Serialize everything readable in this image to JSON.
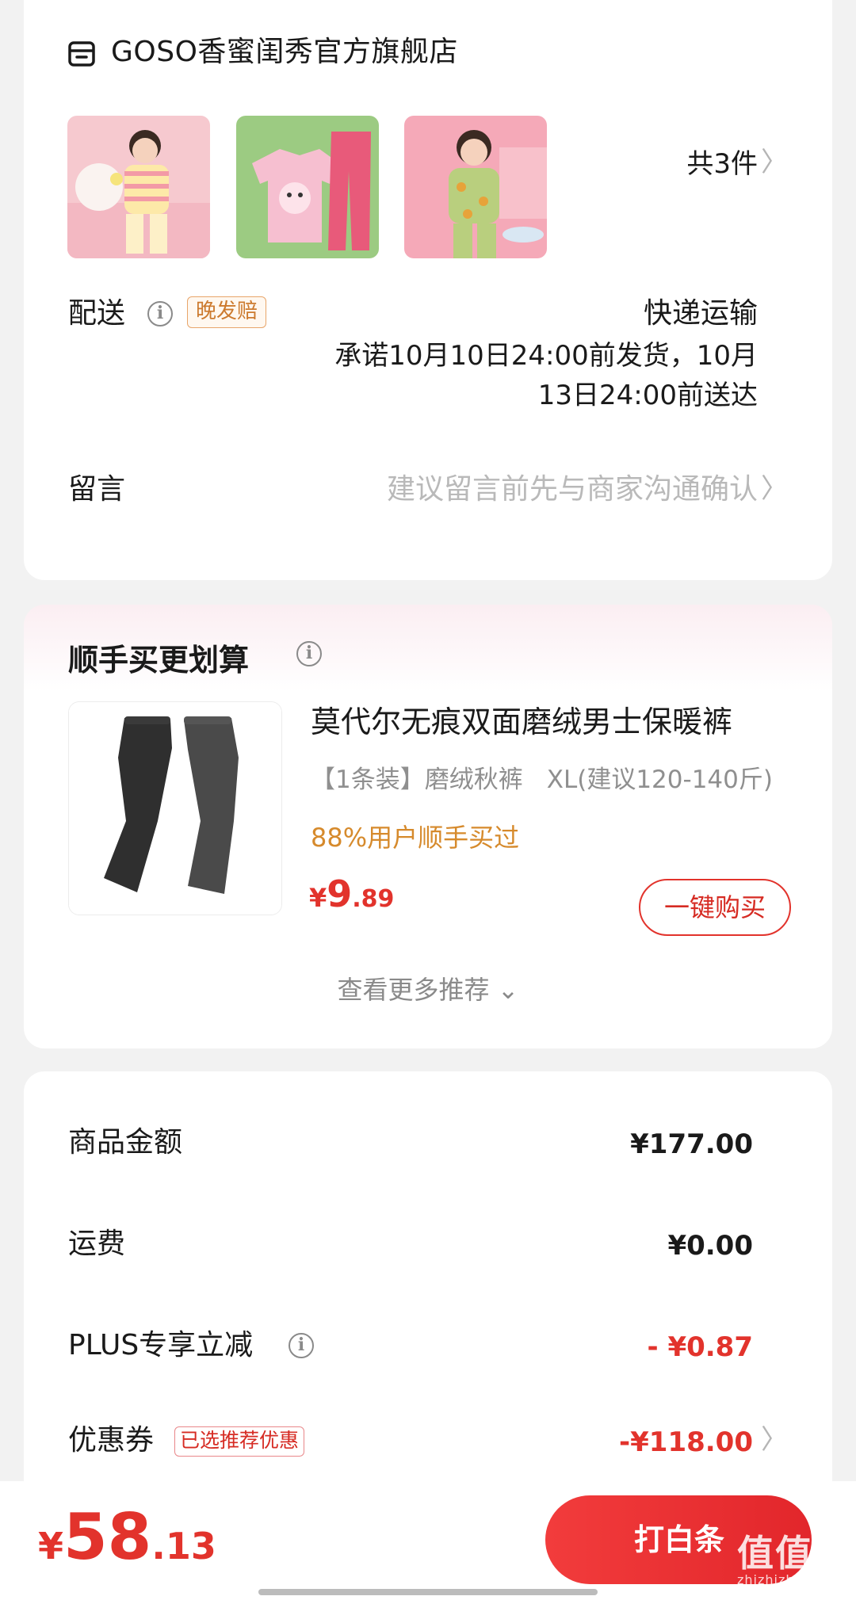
{
  "store": {
    "name": "GOSO香蜜闺秀官方旗舰店",
    "item_count": "共3件",
    "chevron": "〉"
  },
  "delivery": {
    "label": "配送",
    "info": "i",
    "late_tag": "晚发赔",
    "method": "快递运输",
    "promise_line1": "承诺10月10日24:00前发货，10月",
    "promise_line2": "13日24:00前送达"
  },
  "message": {
    "label": "留言",
    "placeholder": "建议留言前先与商家沟通确认"
  },
  "recommendation": {
    "title": "顺手买更划算",
    "product": {
      "title": "莫代尔无痕双面磨绒男士保暖裤",
      "spec": "【1条装】磨绒秋裤",
      "size": "XL(建议120-140斤)",
      "buy_rate": "88%用户顺手买过",
      "price_currency": "¥",
      "price_int": "9",
      "price_dec": ".89",
      "buy_button": "一键购买"
    },
    "see_more": "查看更多推荐 ⌄"
  },
  "totals": {
    "goods_label": "商品金额",
    "goods_value": "¥177.00",
    "shipping_label": "运费",
    "shipping_value": "¥0.00",
    "plus_label": "PLUS专享立减",
    "plus_value": "- ¥0.87",
    "coupon_label": "优惠券",
    "coupon_tag": "已选推荐优惠",
    "coupon_value": "-¥118.00"
  },
  "bottom": {
    "currency": "¥",
    "total_int": "58",
    "total_dec": ".13",
    "pay_button": "打白条"
  },
  "watermark": {
    "text": "值值值",
    "sub": "zhizhizhi.com"
  },
  "colors": {
    "accent_red": "#e2332c",
    "orange": "#d68a2c",
    "muted": "#b9b9b9"
  }
}
